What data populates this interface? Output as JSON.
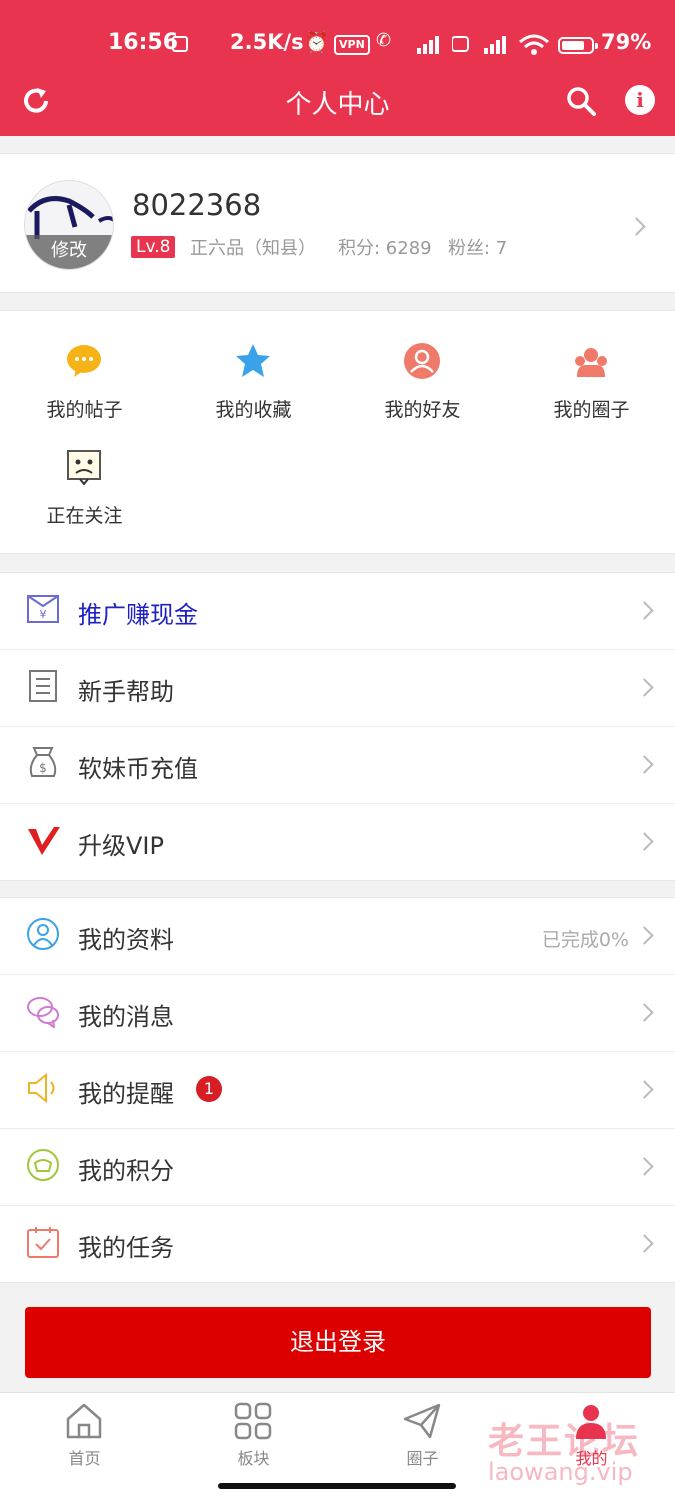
{
  "status_bar": {
    "time": "16:56",
    "speed": "2.5K/s",
    "vpn": "VPN",
    "battery_pct": "79%",
    "battery_level": 0.79
  },
  "header": {
    "title": "个人中心",
    "left_icon": "refresh-icon",
    "right_icons": [
      "search-icon",
      "info-icon"
    ],
    "info_glyph": "i",
    "bg_color": "#e8344e"
  },
  "profile": {
    "username": "8022368",
    "avatar_edit_label": "修改",
    "level": "Lv.8",
    "rank": "正六品（知县）",
    "points": "积分: 6289",
    "fans": "粉丝: 7"
  },
  "grid": {
    "items": [
      {
        "label": "我的帖子",
        "icon": "chat-bubble-icon"
      },
      {
        "label": "我的收藏",
        "icon": "star-icon"
      },
      {
        "label": "我的好友",
        "icon": "friend-icon"
      },
      {
        "label": "我的圈子",
        "icon": "group-icon"
      },
      {
        "label": "正在关注",
        "icon": "follow-face-icon"
      }
    ]
  },
  "menu_group_1": [
    {
      "label": "推广赚现金",
      "icon": "envelope-yen-icon",
      "highlight_color": "#2020c0"
    },
    {
      "label": "新手帮助",
      "icon": "document-icon"
    },
    {
      "label": "软妹币充值",
      "icon": "money-bag-icon"
    },
    {
      "label": "升级VIP",
      "icon": "vip-v-icon"
    }
  ],
  "menu_group_2": [
    {
      "label": "我的资料",
      "icon": "user-profile-icon",
      "extra": "已完成0%"
    },
    {
      "label": "我的消息",
      "icon": "message-icon"
    },
    {
      "label": "我的提醒",
      "icon": "speaker-icon",
      "badge": "1"
    },
    {
      "label": "我的积分",
      "icon": "coin-icon"
    },
    {
      "label": "我的任务",
      "icon": "calendar-check-icon"
    }
  ],
  "logout_label": "退出登录",
  "tabbar": {
    "tabs": [
      {
        "label": "首页",
        "icon": "home-icon"
      },
      {
        "label": "板块",
        "icon": "grid-icon"
      },
      {
        "label": "圈子",
        "icon": "paper-plane-icon"
      },
      {
        "label": "我的",
        "icon": "me-icon",
        "active": true
      }
    ]
  },
  "watermark": {
    "title": "老王论坛",
    "url": "laowang.vip"
  }
}
